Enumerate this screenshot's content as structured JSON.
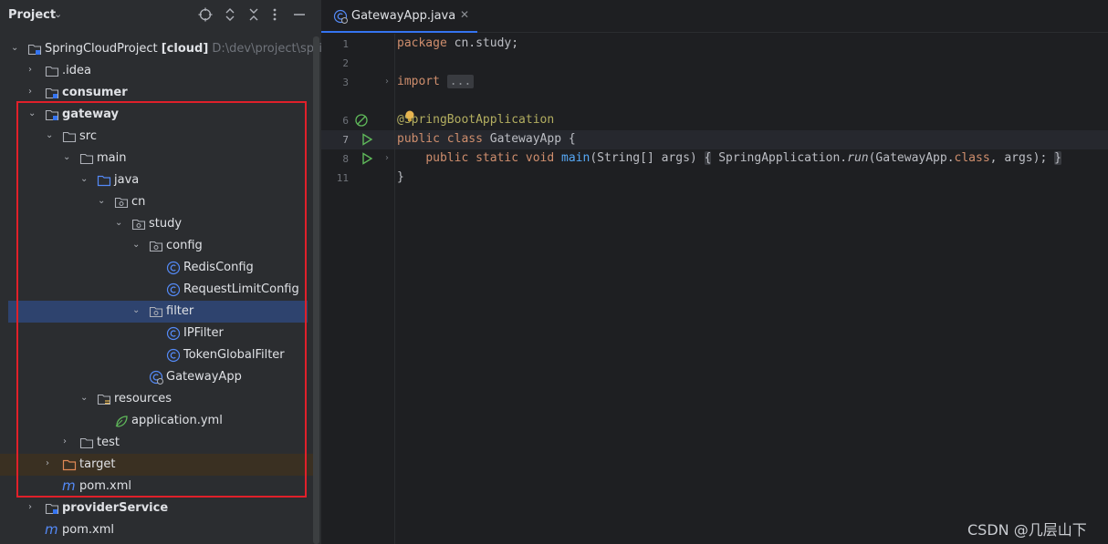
{
  "project_panel": {
    "title": "Project",
    "header_icons": [
      "locate-icon",
      "expand-all-icon",
      "collapse-all-icon",
      "options-icon",
      "hide-icon"
    ],
    "tree": [
      {
        "label": "SpringCloudProject",
        "tag": "[cloud]",
        "path": "D:\\dev\\project\\spring",
        "icon": "module-folder-icon",
        "expanded": true
      },
      {
        "label": ".idea",
        "icon": "folder-icon",
        "expanded": false
      },
      {
        "label": "consumer",
        "icon": "module-folder-icon",
        "expanded": false
      },
      {
        "label": "gateway",
        "icon": "module-folder-icon",
        "expanded": true
      },
      {
        "label": "src",
        "icon": "folder-icon",
        "expanded": true
      },
      {
        "label": "main",
        "icon": "folder-icon",
        "expanded": true
      },
      {
        "label": "java",
        "icon": "source-folder-icon",
        "expanded": true
      },
      {
        "label": "cn",
        "icon": "package-icon",
        "expanded": true
      },
      {
        "label": "study",
        "icon": "package-icon",
        "expanded": true
      },
      {
        "label": "config",
        "icon": "package-icon",
        "expanded": true
      },
      {
        "label": "RedisConfig",
        "icon": "java-class-icon"
      },
      {
        "label": "RequestLimitConfig",
        "icon": "java-class-icon"
      },
      {
        "label": "filter",
        "icon": "package-icon",
        "expanded": true,
        "selected": true
      },
      {
        "label": "IPFilter",
        "icon": "java-class-icon"
      },
      {
        "label": "TokenGlobalFilter",
        "icon": "java-class-icon"
      },
      {
        "label": "GatewayApp",
        "icon": "spring-boot-class-icon"
      },
      {
        "label": "resources",
        "icon": "resources-folder-icon",
        "expanded": true
      },
      {
        "label": "application.yml",
        "icon": "spring-config-icon"
      },
      {
        "label": "test",
        "icon": "folder-icon",
        "expanded": false
      },
      {
        "label": "target",
        "icon": "excluded-folder-icon",
        "expanded": false
      },
      {
        "label": "pom.xml",
        "icon": "maven-icon"
      },
      {
        "label": "providerService",
        "icon": "module-folder-icon",
        "expanded": false
      },
      {
        "label": "pom.xml",
        "icon": "maven-icon"
      }
    ]
  },
  "editor": {
    "tab_label": "GatewayApp.java",
    "line_numbers": [
      "1",
      "2",
      "3",
      "6",
      "7",
      "8",
      "11"
    ],
    "code": {
      "l1_kw": "package",
      "l1_rest": " cn.study;",
      "l3_kw": "import",
      "l3_fold": "...",
      "l6_at": "@",
      "l6_ann": "SpringBootApplication",
      "l7_kw": "public class",
      "l7_rest": " GatewayApp {",
      "l8_kw1": "public static void",
      "l8_fn": "main",
      "l8_args": "(String[] args)",
      "l8_open": "{",
      "l8_body1": " SpringApplication.",
      "l8_run": "run",
      "l8_body2": "(GatewayApp.",
      "l8_class": "class",
      "l8_body3": ", args);",
      "l8_close": "}",
      "l11": "}"
    }
  },
  "watermark": "CSDN @几层山下",
  "colors": {
    "selection": "#2e436e",
    "highlight_border": "#e0202a",
    "keyword": "#cf8e6d",
    "annotation": "#b3ae60",
    "method": "#56a8f5"
  }
}
